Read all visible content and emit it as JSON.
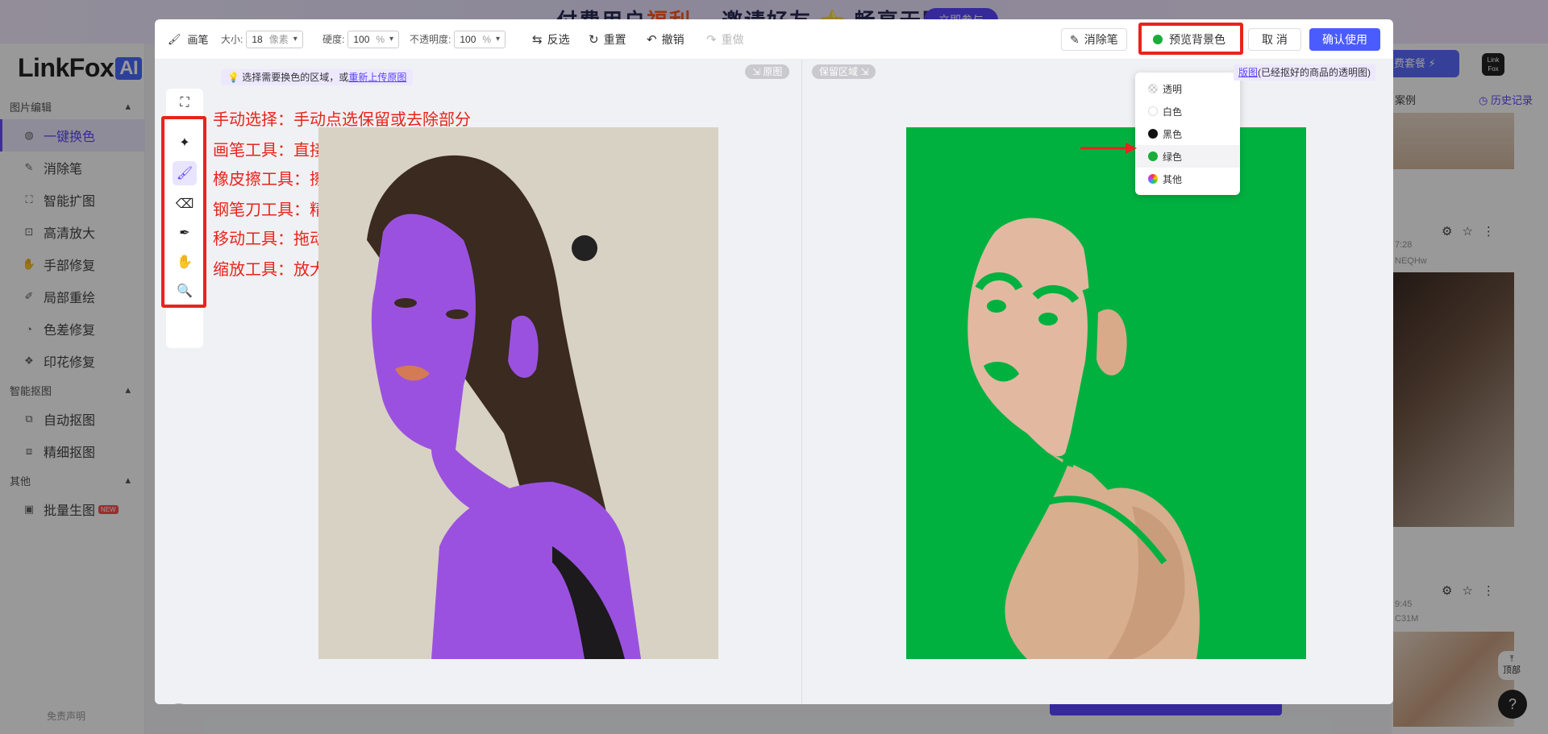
{
  "background": {
    "banner_promo_1": "付费用户",
    "banner_promo_hl": "福利",
    "banner_promo_2": "邀请好友",
    "banner_promo_3": "畅享无限算力",
    "banner_join": "立即参与",
    "logo_text": "LinkFox",
    "logo_ai": "AI",
    "nav": {
      "group1": "图片编辑",
      "items1": [
        {
          "label": "一键换色",
          "icon": "palette-icon",
          "active": true
        },
        {
          "label": "消除笔",
          "icon": "eraser-pen-icon"
        },
        {
          "label": "智能扩图",
          "icon": "expand-icon"
        },
        {
          "label": "高清放大",
          "icon": "upscale-icon"
        },
        {
          "label": "手部修复",
          "icon": "hand-icon"
        },
        {
          "label": "局部重绘",
          "icon": "brush-icon"
        },
        {
          "label": "色差修复",
          "icon": "color-fix-icon"
        },
        {
          "label": "印花修复",
          "icon": "print-icon"
        }
      ],
      "group2": "智能抠图",
      "items2": [
        {
          "label": "自动抠图",
          "icon": "auto-cutout-icon"
        },
        {
          "label": "精细抠图",
          "icon": "fine-cutout-icon"
        }
      ],
      "group3": "其他",
      "items3": [
        {
          "label": "批量生图",
          "icon": "image-icon",
          "badge": "NEW"
        }
      ]
    },
    "disclaimer": "免责声明",
    "renew": "续费套餐",
    "examples": "案例",
    "history": "历史记录",
    "card_meta1": "7:28",
    "card_id1": "NEQHw",
    "card_meta2": "9:45",
    "card_id2": "C31M",
    "top_btn": "顶部",
    "avatar_text": "Link Fox"
  },
  "toolbar": {
    "brush_label": "画笔",
    "size_label": "大小:",
    "size_value": "18",
    "size_unit": "像素",
    "hardness_label": "硬度:",
    "hardness_value": "100",
    "hardness_unit": "%",
    "opacity_label": "不透明度:",
    "opacity_value": "100",
    "opacity_unit": "%",
    "invert": "反选",
    "reset": "重置",
    "undo": "撤销",
    "redo": "重做",
    "eraser_pen": "消除笔",
    "preview_bg": "预览背景色",
    "cancel": "取 消",
    "confirm": "确认使用"
  },
  "dropdown": {
    "options": [
      {
        "label": "透明",
        "swatch": "checker"
      },
      {
        "label": "白色",
        "swatch": "#ffffff"
      },
      {
        "label": "黑色",
        "swatch": "#111111"
      },
      {
        "label": "绿色",
        "swatch": "#1aad3a"
      },
      {
        "label": "其他",
        "swatch": "rainbow"
      }
    ],
    "highlighted_index": 3
  },
  "left": {
    "tip_text": "选择需要换色的区域，或",
    "tip_link": "重新上传原图",
    "badge": "原图",
    "annotations": [
      "手动选择：手动点选保留或去除部分",
      "画笔工具：直接涂抹需要换色区域",
      "橡皮擦工具：擦除多余区域",
      "钢笔刀工具：精准描点抠图",
      "移动工具：拖动图片",
      "缩放工具：放大、缩小图片"
    ]
  },
  "right": {
    "badge": "保留区域",
    "note_link": "版图",
    "note_text": "(已经抠好的商品的透明图)"
  },
  "colors": {
    "accent": "#5b45ff",
    "annotation_red": "#e8241c",
    "preview_green": "#00b140",
    "mask_purple": "#9b51e0"
  }
}
